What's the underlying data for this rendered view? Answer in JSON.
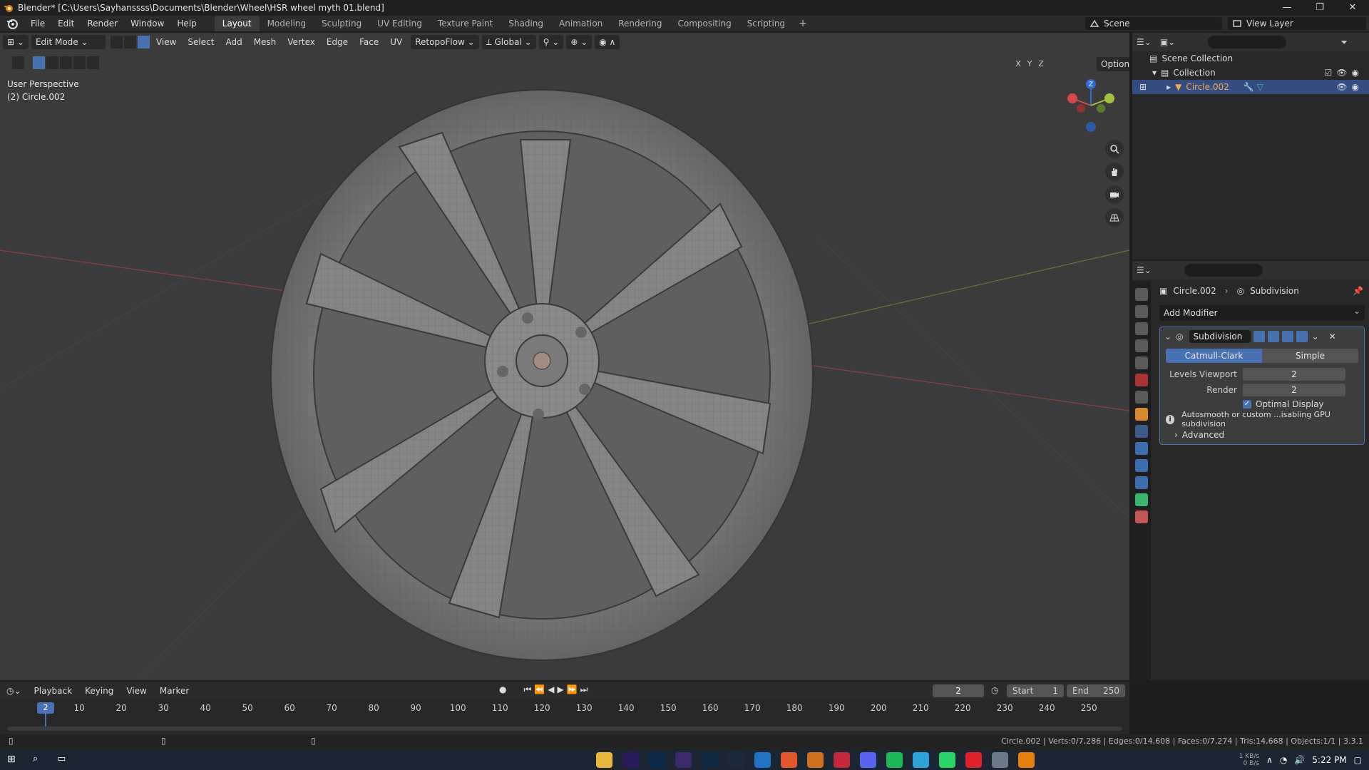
{
  "window": {
    "title": "Blender* [C:\\Users\\Sayhanssss\\Documents\\Blender\\Wheel\\HSR wheel myth 01.blend]",
    "controls": [
      "—",
      "❐",
      "✕"
    ]
  },
  "menu": [
    "File",
    "Edit",
    "Render",
    "Window",
    "Help"
  ],
  "workspaces": [
    "Layout",
    "Modeling",
    "Sculpting",
    "UV Editing",
    "Texture Paint",
    "Shading",
    "Animation",
    "Rendering",
    "Compositing",
    "Scripting"
  ],
  "workspace_active": "Layout",
  "scene": {
    "name": "Scene",
    "view_layer": "View Layer"
  },
  "viewport": {
    "mode": "Edit Mode",
    "header_menus": [
      "View",
      "Select",
      "Add",
      "Mesh",
      "Vertex",
      "Edge",
      "Face",
      "UV"
    ],
    "addon": "RetopoFlow",
    "orientation": "Global",
    "options": "Options",
    "axes": [
      "X",
      "Y",
      "Z"
    ],
    "perspective": "User Perspective",
    "object_label": "(2) Circle.002",
    "gizmo": {
      "x": "X",
      "y": "Y",
      "z": "Z"
    }
  },
  "outliner": {
    "scene_collection": "Scene Collection",
    "collection": "Collection",
    "object": "Circle.002"
  },
  "properties": {
    "breadcrumb_object": "Circle.002",
    "breadcrumb_modifier": "Subdivision",
    "add_modifier": "Add Modifier",
    "modifier": {
      "name": "Subdivision",
      "types": [
        "Catmull-Clark",
        "Simple"
      ],
      "levels_viewport_label": "Levels Viewport",
      "levels_viewport": "2",
      "render_label": "Render",
      "render": "2",
      "optimal_display": "Optimal Display",
      "warning": "Autosmooth or custom ...isabling GPU subdivision",
      "advanced": "Advanced"
    }
  },
  "timeline": {
    "menus": [
      "Playback",
      "Keying",
      "View",
      "Marker"
    ],
    "current_frame": "2",
    "start_label": "Start",
    "start": "1",
    "end_label": "End",
    "end": "250",
    "ticks": [
      "10",
      "20",
      "30",
      "40",
      "50",
      "60",
      "70",
      "80",
      "90",
      "100",
      "110",
      "120",
      "130",
      "140",
      "150",
      "160",
      "170",
      "180",
      "190",
      "200",
      "210",
      "220",
      "230",
      "240",
      "250"
    ]
  },
  "status": "Circle.002 | Verts:0/7,286 | Edges:0/14,608 | Faces:0/7,274 | Tris:14,668 | Objects:1/1 | 3.3.1",
  "taskbar": {
    "time": "5:22 PM",
    "net_up": "1 KB/s",
    "net_down": "0 B/s"
  },
  "colors": {
    "accent": "#4772b3",
    "viewport_bg": "#3b3b3b",
    "panel_bg": "#282828",
    "object_orange": "#f5a94d"
  }
}
